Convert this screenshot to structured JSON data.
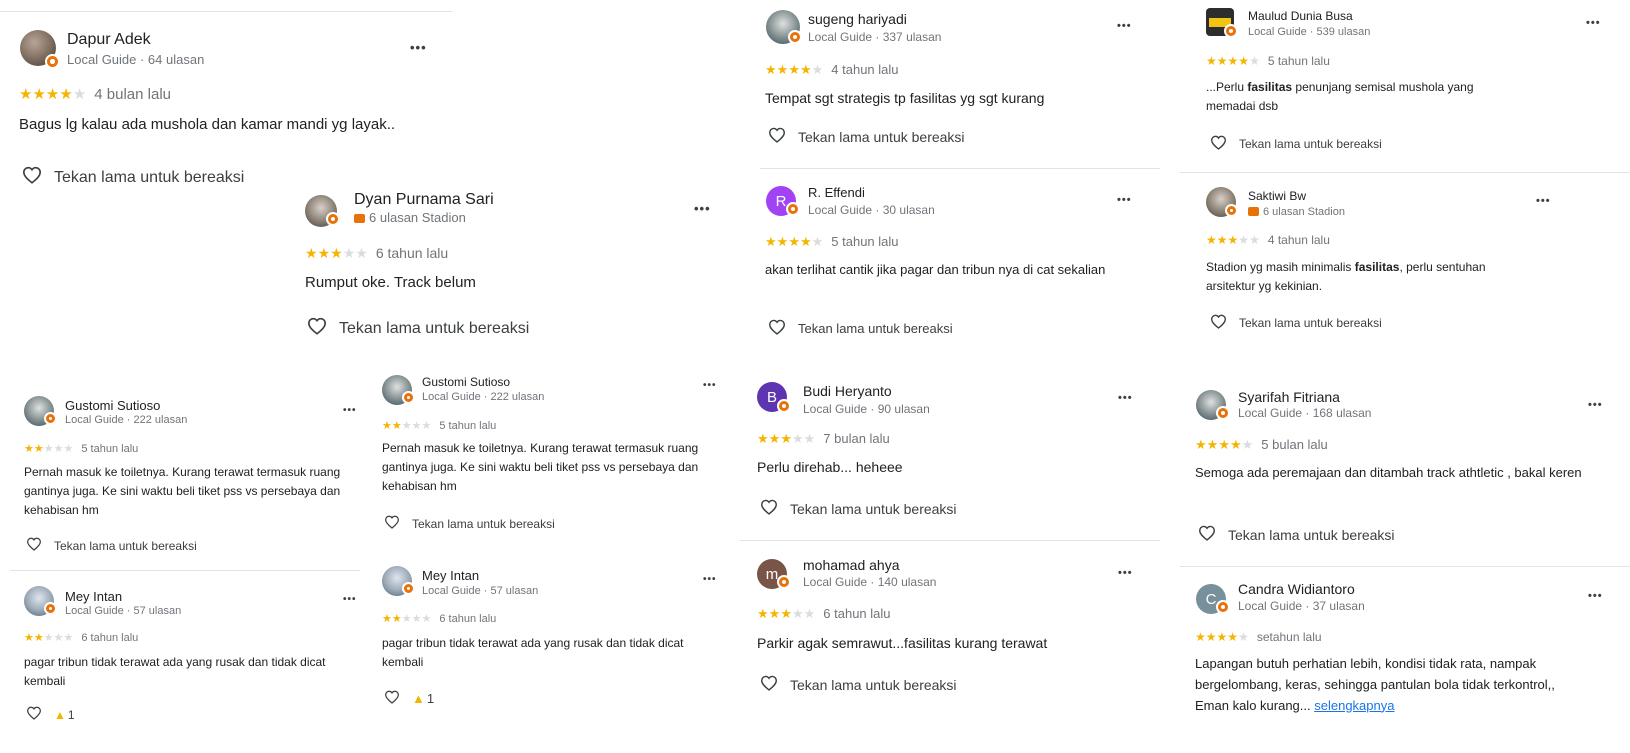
{
  "reaction_label": "Tekan lama untuk bereaksi",
  "more_label": "•••",
  "colors": {
    "star": "#f4b400",
    "star_empty": "#dadce0",
    "badge": "#e8710a",
    "meta": "#70757a",
    "link": "#1a73e8"
  },
  "reviews": [
    {
      "name": "Dapur Adek",
      "meta": "Local Guide · 64 ulasan",
      "rating": 4,
      "time": "4 bulan lalu",
      "text": "Bagus lg kalau ada mushola dan kamar mandi yg layak..",
      "reaction": "Tekan lama untuk bereaksi"
    },
    {
      "name": "Dyan Purnama Sari",
      "meta": "6 ulasan Stadion",
      "rating": 3,
      "time": "6 tahun lalu",
      "text": "Rumput oke. Track belum",
      "reaction": "Tekan lama untuk bereaksi"
    },
    {
      "name": "Gustomi Sutioso",
      "meta": "Local Guide · 222 ulasan",
      "rating": 2,
      "time": "5 tahun lalu",
      "text": "Pernah masuk ke toiletnya. Kurang terawat termasuk ruang gantinya juga. Ke sini waktu beli tiket pss vs persebaya dan kehabisan hm",
      "reaction": "Tekan lama untuk bereaksi"
    },
    {
      "name": "Gustomi Sutioso",
      "meta": "Local Guide · 222 ulasan",
      "rating": 2,
      "time": "5 tahun lalu",
      "text": "Pernah masuk ke toiletnya. Kurang terawat termasuk ruang gantinya juga. Ke sini waktu beli tiket pss vs persebaya dan kehabisan hm",
      "reaction": "Tekan lama untuk bereaksi"
    },
    {
      "name": "Mey Intan",
      "meta": "Local Guide · 57 ulasan",
      "rating": 2,
      "time": "6 tahun lalu",
      "text": "pagar tribun tidak terawat ada yang rusak dan tidak dicat kembali",
      "reaction_count": "1"
    },
    {
      "name": "Mey Intan",
      "meta": "Local Guide · 57 ulasan",
      "rating": 2,
      "time": "6 tahun lalu",
      "text": "pagar tribun tidak terawat ada yang rusak dan tidak dicat kembali",
      "reaction_count": "1"
    },
    {
      "name": "sugeng hariyadi",
      "meta": "Local Guide · 337 ulasan",
      "rating": 4,
      "time": "4 tahun lalu",
      "text": "Tempat sgt strategis tp fasilitas yg sgt kurang",
      "reaction": "Tekan lama untuk bereaksi"
    },
    {
      "name": "R. Effendi",
      "initial": "R",
      "meta": "Local Guide · 30 ulasan",
      "rating": 4,
      "time": "5 tahun lalu",
      "text": "akan terlihat cantik jika pagar dan tribun nya di cat sekalian",
      "reaction": "Tekan lama untuk bereaksi"
    },
    {
      "name": "Budi Heryanto",
      "initial": "B",
      "meta": "Local Guide · 90 ulasan",
      "rating": 3,
      "time": "7 bulan lalu",
      "text": "Perlu direhab... heheee",
      "reaction": "Tekan lama untuk bereaksi"
    },
    {
      "name": "mohamad ahya",
      "initial": "m",
      "meta": "Local Guide · 140 ulasan",
      "rating": 3,
      "time": "6 tahun lalu",
      "text": "Parkir agak semrawut...fasilitas kurang terawat",
      "reaction": "Tekan lama untuk bereaksi"
    },
    {
      "name": "Maulud Dunia Busa",
      "meta": "Local Guide · 539 ulasan",
      "rating": 4,
      "time": "5 tahun lalu",
      "text_pre": "...Perlu ",
      "text_bold": "fasilitas",
      "text_post": " penunjang semisal mushola yang memadai dsb",
      "reaction": "Tekan lama untuk bereaksi"
    },
    {
      "name": "Saktiwi Bw",
      "meta": "6 ulasan Stadion",
      "rating": 3,
      "time": "4 tahun lalu",
      "text_pre": "Stadion yg masih minimalis ",
      "text_bold": "fasilitas",
      "text_post": ", perlu sentuhan arsitektur yg kekinian.",
      "reaction": "Tekan lama untuk bereaksi"
    },
    {
      "name": "Syarifah Fitriana",
      "meta": "Local Guide · 168 ulasan",
      "rating": 4,
      "time": "5 bulan lalu",
      "text": "Semoga ada peremajaan dan ditambah track athtletic , bakal keren",
      "reaction": "Tekan lama untuk bereaksi"
    },
    {
      "name": "Candra Widiantoro",
      "initial": "C",
      "meta": "Local Guide · 37 ulasan",
      "rating": 4,
      "time": "setahun lalu",
      "text": "Lapangan butuh perhatian lebih, kondisi tidak rata, nampak bergelombang, keras, sehingga pantulan bola tidak terkontrol,, Eman kalo kurang... ",
      "more_link": "selengkapnya"
    }
  ]
}
